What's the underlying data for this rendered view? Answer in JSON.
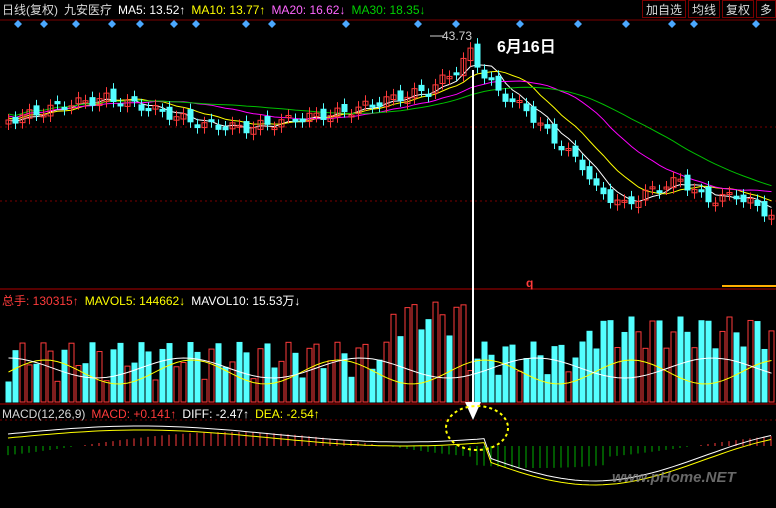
{
  "main_header": {
    "period": "日线(复权)",
    "stock_name": "九安医疗",
    "ma5": "MA5: 13.52↑",
    "ma10": "MA10: 13.77↑",
    "ma20": "MA20: 16.62↓",
    "ma30": "MA30: 18.35↓"
  },
  "toolbar": {
    "add_label": "加自选",
    "avg_label": "均线",
    "adj_label": "复权",
    "more_label": "多"
  },
  "annotations": {
    "high_price": "43.73",
    "date_label": "6月16日",
    "q_marker": "q"
  },
  "volume_header": {
    "total": "总手: 130315↑",
    "mavol5": "MAVOL5: 144662↓",
    "mavol10": "MAVOL10: 15.53万↓"
  },
  "macd_header": {
    "name": "MACD(12,26,9)",
    "macd": "MACD: +0.141↑",
    "diff": "DIFF: -2.47↑",
    "dea": "DEA: -2.54↑"
  },
  "watermark": "www.pHome.NET",
  "colors": {
    "up": "#ff3b3b",
    "down": "#54ffff",
    "ma5": "#ffffff",
    "ma10": "#ffff00",
    "ma20": "#ff00ff",
    "ma30": "#00c000",
    "grid": "#7a0000",
    "arrow": "#ffffff",
    "macd_pos": "#ff3b3b",
    "macd_neg": "#00b000",
    "circle": "#ffff00"
  },
  "chart_data": {
    "type": "candlestick",
    "price_high": 43.73,
    "ma_lines": [
      "MA5",
      "MA10",
      "MA20",
      "MA30"
    ],
    "highlight_date": "6月16日",
    "macd": {
      "macd": 0.141,
      "diff": -2.47,
      "dea": -2.54
    },
    "volume": {
      "total": 130315,
      "mavol5": 144662,
      "mavol10": "15.53万"
    }
  }
}
